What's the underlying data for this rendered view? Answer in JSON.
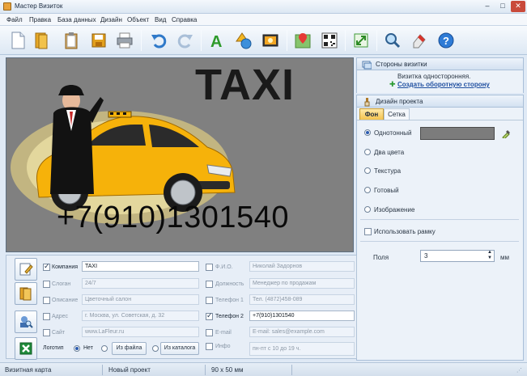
{
  "window": {
    "title": "Мастер Визиток",
    "minimize": "–",
    "maximize": "□",
    "close": "✕"
  },
  "menu": [
    "Файл",
    "Правка",
    "База данных",
    "Дизайн",
    "Объект",
    "Вид",
    "Справка"
  ],
  "toolbar": [
    {
      "icon": "new-document-icon"
    },
    {
      "icon": "open-folder-icon"
    },
    {
      "icon": "clipboard-icon"
    },
    {
      "icon": "save-icon"
    },
    {
      "icon": "print-icon"
    },
    {
      "icon": "undo-icon"
    },
    {
      "icon": "redo-icon"
    },
    {
      "icon": "text-icon"
    },
    {
      "icon": "shapes-icon"
    },
    {
      "icon": "image-icon"
    },
    {
      "icon": "map-icon"
    },
    {
      "icon": "qr-code-icon"
    },
    {
      "icon": "resize-icon"
    },
    {
      "icon": "zoom-icon"
    },
    {
      "icon": "eraser-icon"
    },
    {
      "icon": "help-icon"
    }
  ],
  "card": {
    "title": "TAXI",
    "phone": "+7(910)1301540",
    "background_color": "#808080",
    "car_color": "#f6b20a"
  },
  "right_panel": {
    "sides": {
      "header": "Стороны визитки",
      "info": "Визитка односторонняя.",
      "link": "Создать оборотную сторону"
    },
    "design": {
      "header": "Дизайн проекта",
      "tabs": [
        {
          "label": "Фон",
          "active": true
        },
        {
          "label": "Сетка",
          "active": false
        }
      ],
      "options": [
        {
          "label": "Однотонный",
          "selected": true
        },
        {
          "label": "Два цвета",
          "selected": false
        },
        {
          "label": "Текстура",
          "selected": false
        },
        {
          "label": "Готовый",
          "selected": false
        },
        {
          "label": "Изображение",
          "selected": false
        }
      ],
      "swatch_color": "#7c7c7c",
      "use_frame_label": "Использовать рамку",
      "margins_label": "Поля",
      "margins_value": "3",
      "margins_unit": "мм"
    }
  },
  "form": {
    "left_fields": [
      {
        "label": "Компания",
        "value": "TAXI",
        "checked": true
      },
      {
        "label": "Слоган",
        "value": "24/7",
        "checked": false
      },
      {
        "label": "Описание",
        "value": "Цветочный салон",
        "checked": false
      },
      {
        "label": "Адрес",
        "value": "г. Москва, ул. Советская, д. 32",
        "checked": false
      },
      {
        "label": "Сайт",
        "value": "www.LaFleur.ru",
        "checked": false
      }
    ],
    "right_fields": [
      {
        "label": "Ф.И.О.",
        "value": "Николай Задорнов",
        "checked": false
      },
      {
        "label": "Должность",
        "value": "Менеджер по продажам",
        "checked": false
      },
      {
        "label": "Телефон 1",
        "value": "Тел. (4872)458-089",
        "checked": false
      },
      {
        "label": "Телефон 2",
        "value": "+7(910)1301540",
        "checked": true
      },
      {
        "label": "E-mail",
        "value": "E-mail: sales@example.com",
        "checked": false
      },
      {
        "label": "Инфо",
        "value": "пн-пт с 10 до 19 ч.",
        "checked": false
      }
    ],
    "logo": {
      "label": "Логотип",
      "none_label": "Нет",
      "from_file": "Из файла",
      "from_catalog": "Из каталога"
    }
  },
  "status": {
    "type": "Визитная карта",
    "project": "Новый проект",
    "size": "90 x 50 мм"
  }
}
